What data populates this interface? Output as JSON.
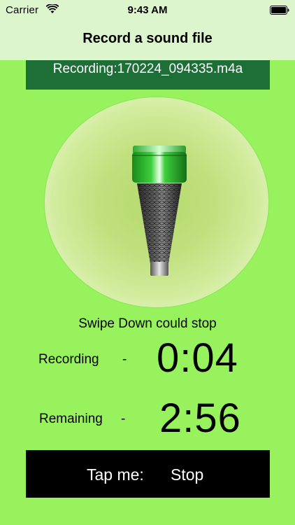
{
  "status_bar": {
    "carrier": "Carrier",
    "time": "9:43 AM",
    "wifi_icon": "wifi-icon",
    "battery_icon": "battery-icon"
  },
  "nav": {
    "title": "Record a sound file"
  },
  "file_banner": {
    "text": "Recording:170224_094335.m4a"
  },
  "microphone": {
    "icon": "microphone-icon"
  },
  "hint": "Swipe Down could stop",
  "recording": {
    "label": "Recording",
    "dash": "-",
    "time": "0:04"
  },
  "remaining": {
    "label": "Remaining",
    "dash": "-",
    "time": "2:56"
  },
  "stop_button": {
    "tap_label": "Tap me:",
    "action_label": "Stop"
  },
  "colors": {
    "background": "#97f25e",
    "bar": "#ddf5cc",
    "banner": "#1e6e38",
    "button": "#000000"
  }
}
